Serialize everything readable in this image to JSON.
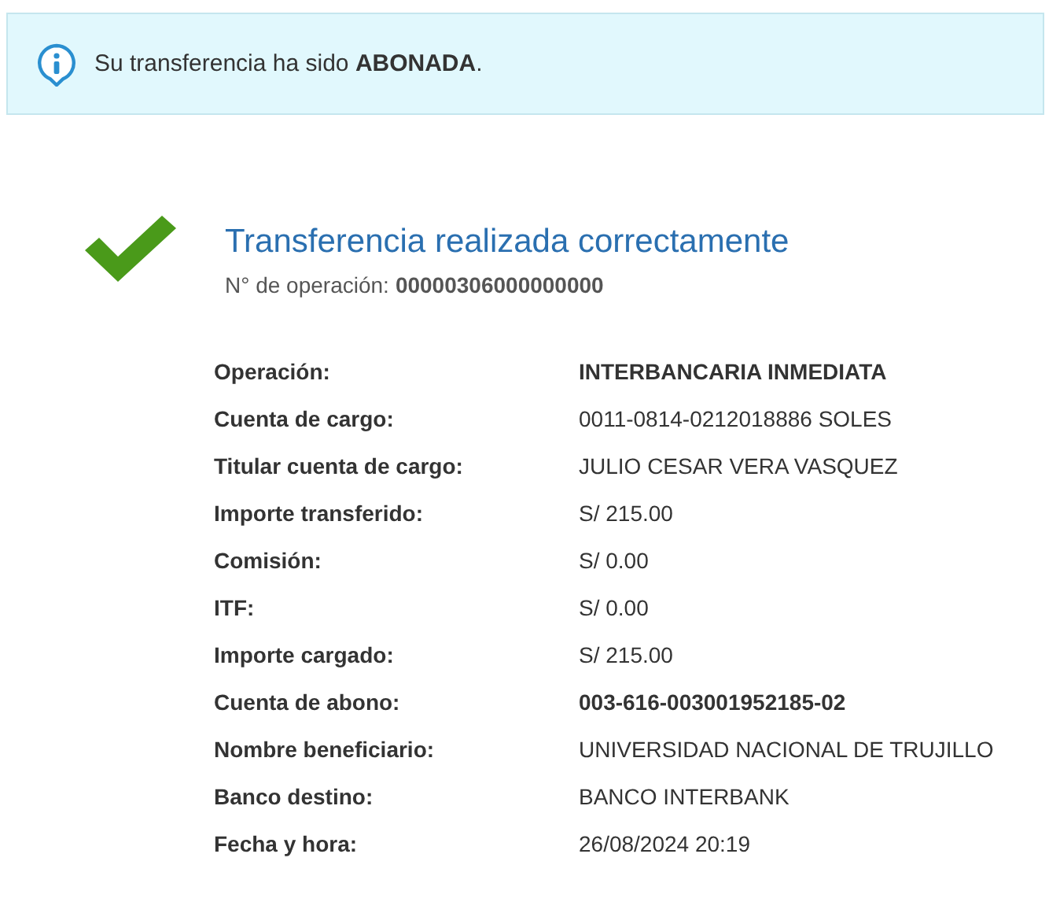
{
  "notice": {
    "text": "Su transferencia ha sido **ABONADA**."
  },
  "result": {
    "title": "Transferencia realizada correctamente",
    "operation_label": "N° de operación:",
    "operation_number": "00000306000000000"
  },
  "details": [
    {
      "label": "Operación:",
      "value": "INTERBANCARIA INMEDIATA",
      "bold": true
    },
    {
      "label": "Cuenta de cargo:",
      "value": "0011-0814-0212018886 SOLES",
      "bold": false
    },
    {
      "label": "Titular cuenta de cargo:",
      "value": "JULIO CESAR VERA VASQUEZ",
      "bold": false
    },
    {
      "label": "Importe transferido:",
      "value": "S/ 215.00",
      "bold": false
    },
    {
      "label": "Comisión:",
      "value": "S/ 0.00",
      "bold": false
    },
    {
      "label": "ITF:",
      "value": "S/ 0.00",
      "bold": false
    },
    {
      "label": "Importe cargado:",
      "value": "S/ 215.00",
      "bold": false
    },
    {
      "label": "Cuenta de abono:",
      "value": "003-616-003001952185-02",
      "bold": true
    },
    {
      "label": "Nombre beneficiario:",
      "value": "UNIVERSIDAD NACIONAL DE TRUJILLO",
      "bold": false
    },
    {
      "label": "Banco destino:",
      "value": "BANCO INTERBANK",
      "bold": false
    },
    {
      "label": "Fecha y hora:",
      "value": "26/08/2024 20:19",
      "bold": false
    }
  ]
}
